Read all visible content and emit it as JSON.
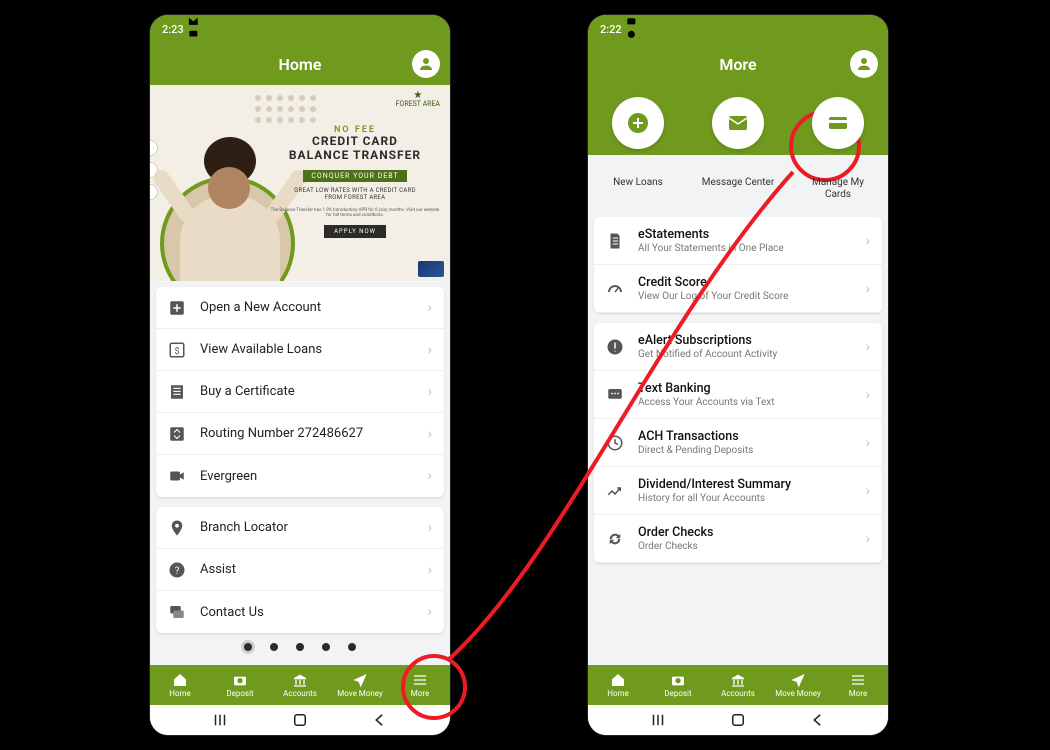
{
  "left": {
    "status": {
      "time": "2:23",
      "icons_left": "🖼 ✉ 💬 •",
      "icons_right": "📶 ▮"
    },
    "header": {
      "title": "Home"
    },
    "banner": {
      "nofee": "NO FEE",
      "headline": "CREDIT CARD\nBALANCE TRANSFER",
      "badge": "CONQUER YOUR DEBT",
      "sub1": "GREAT LOW RATES WITH A CREDIT CARD\nFROM FOREST AREA",
      "sub2": "The Balance Transfer has 1.9% Introductory APR for 6 (six) months. Visit our website for full terms and conditions.",
      "apply": "APPLY NOW",
      "logo": "FOREST AREA"
    },
    "list1": [
      {
        "icon": "plus-box",
        "label": "Open a New Account"
      },
      {
        "icon": "dollar-box",
        "label": "View Available Loans"
      },
      {
        "icon": "receipt",
        "label": "Buy a Certificate"
      },
      {
        "icon": "swap",
        "label": "Routing Number 272486627"
      },
      {
        "icon": "video",
        "label": "Evergreen"
      }
    ],
    "list2": [
      {
        "icon": "pin",
        "label": "Branch Locator"
      },
      {
        "icon": "help",
        "label": "Assist"
      },
      {
        "icon": "chat",
        "label": "Contact Us"
      }
    ]
  },
  "right": {
    "status": {
      "time": "2:22",
      "icons_left": "✉ 🖼 ⊙ •"
    },
    "header": {
      "title": "More"
    },
    "quick": [
      {
        "icon": "plus",
        "label": "New Loans"
      },
      {
        "icon": "mail",
        "label": "Message Center"
      },
      {
        "icon": "card",
        "label": "Manage My Cards"
      }
    ],
    "group1": [
      {
        "icon": "doc",
        "title": "eStatements",
        "sub": "All Your Statements in One Place"
      },
      {
        "icon": "gauge",
        "title": "Credit Score",
        "sub": "View Our Log of Your Credit Score"
      }
    ],
    "group2": [
      {
        "icon": "alert",
        "title": "eAlert Subscriptions",
        "sub": "Get Notified of Account Activity"
      },
      {
        "icon": "sms",
        "title": "Text Banking",
        "sub": "Access Your Accounts via Text"
      },
      {
        "icon": "clock",
        "title": "ACH Transactions",
        "sub": "Direct & Pending Deposits"
      },
      {
        "icon": "trend",
        "title": "Dividend/Interest Summary",
        "sub": "History for all Your Accounts"
      },
      {
        "icon": "loop",
        "title": "Order Checks",
        "sub": "Order Checks"
      }
    ]
  },
  "nav": [
    {
      "icon": "home",
      "label": "Home"
    },
    {
      "icon": "camera",
      "label": "Deposit"
    },
    {
      "icon": "bank",
      "label": "Accounts"
    },
    {
      "icon": "send",
      "label": "Move Money"
    },
    {
      "icon": "menu",
      "label": "More"
    }
  ]
}
